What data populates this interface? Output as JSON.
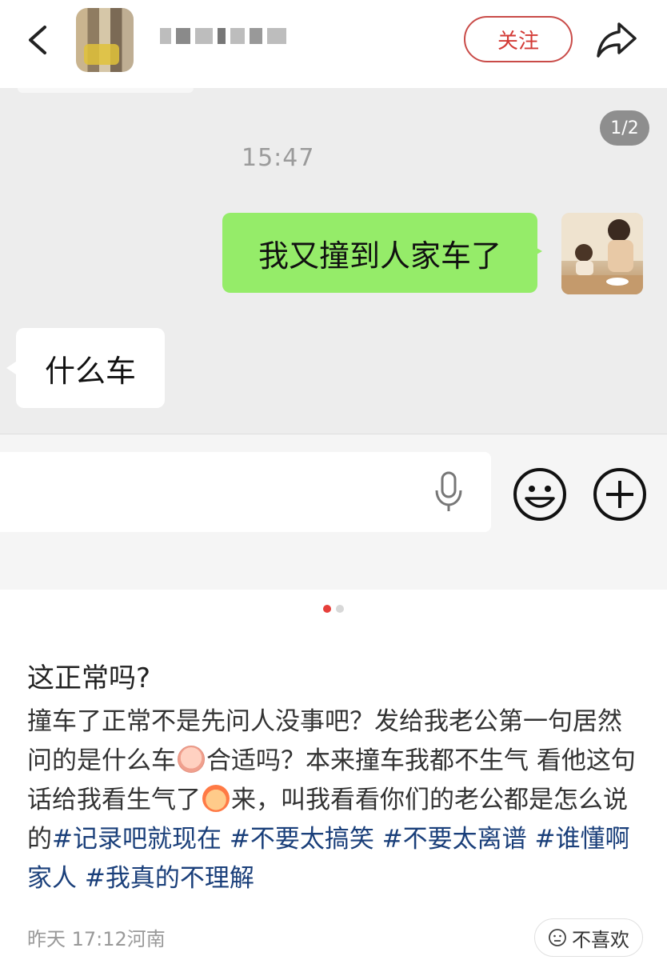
{
  "header": {
    "follow_label": "关注"
  },
  "chat": {
    "page_badge": "1/2",
    "time": "15:47",
    "my_message": "我又撞到人家车了",
    "reply_message": "什么车"
  },
  "post": {
    "title": "这正常吗?",
    "body_part1": "撞车了正常不是先问人没事吧？发给我老公第一句居然问的是什么车",
    "body_part2": "合适吗？本来撞车我都不生气 看他这句话给我看生气了",
    "body_part3": "来，叫我看看你们的老公都是怎么说的",
    "tags": [
      "#记录吧就现在",
      "#不要太搞笑",
      "#不要太离谱",
      "#谁懂啊家人",
      "#我真的不理解"
    ],
    "meta": "昨天 17:12河南",
    "dislike_label": "不喜欢"
  },
  "colors": {
    "accent": "#d33a35",
    "my_bubble": "#95ec69",
    "tag": "#1a3f7a"
  }
}
